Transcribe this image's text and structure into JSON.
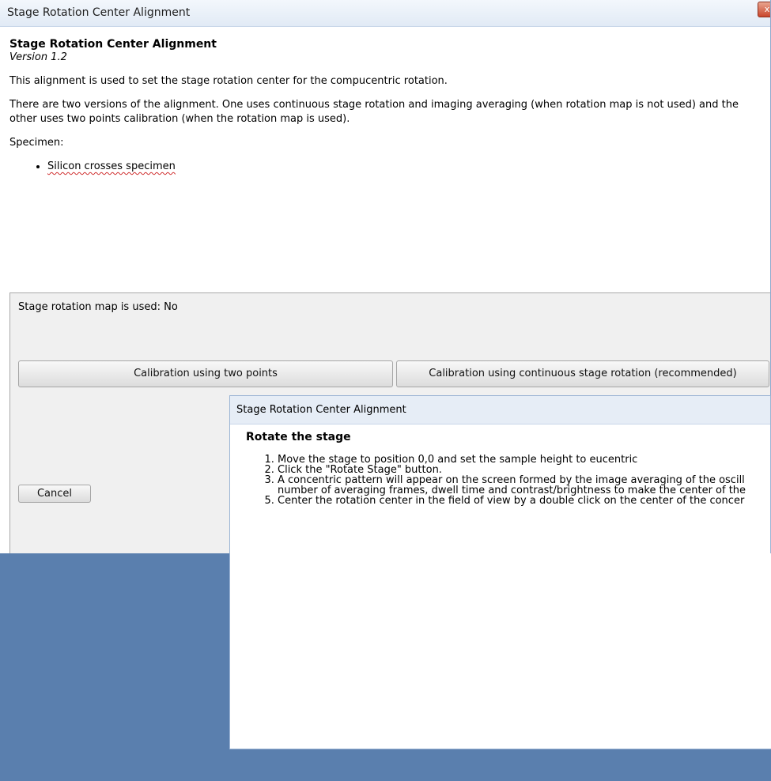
{
  "window": {
    "title": "Stage Rotation Center Alignment",
    "close_label": "x"
  },
  "info": {
    "heading": "Stage Rotation Center Alignment",
    "version": "Version 1.2",
    "purpose": "This alignment is used to set the stage rotation center for the compucentric rotation.",
    "versions_text": "There are two versions of the alignment. One uses continuous stage rotation and imaging averaging (when rotation map is not used) and the other uses two points calibration (when the rotation map is used).",
    "specimen_label": "Specimen:",
    "specimens": [
      "Silicon crosses specimen"
    ]
  },
  "panel": {
    "map_status": "Stage rotation map is used: No",
    "btn_two_points": "Calibration using two points",
    "btn_continuous": "Calibration using continuous stage rotation (recommended)",
    "btn_cancel": "Cancel"
  },
  "popup": {
    "title": "Stage Rotation Center Alignment",
    "heading": "Rotate the stage",
    "steps": [
      "Move the stage to position 0,0 and set the sample height to eucentric",
      "Click the \"Rotate Stage\" button.",
      "A concentric pattern will appear on the screen formed by the image averaging of the oscill",
      "number of averaging frames, dwell time and contrast/brightness to make the center of the",
      "Center the rotation center in the field of view by a double click on the center of the concer"
    ]
  },
  "colors": {
    "desktop": "#5a7fae",
    "titlebar": "#e1eaf5",
    "panel": "#f0f0f0",
    "close": "#c9462c",
    "spelling": "#d03030"
  }
}
